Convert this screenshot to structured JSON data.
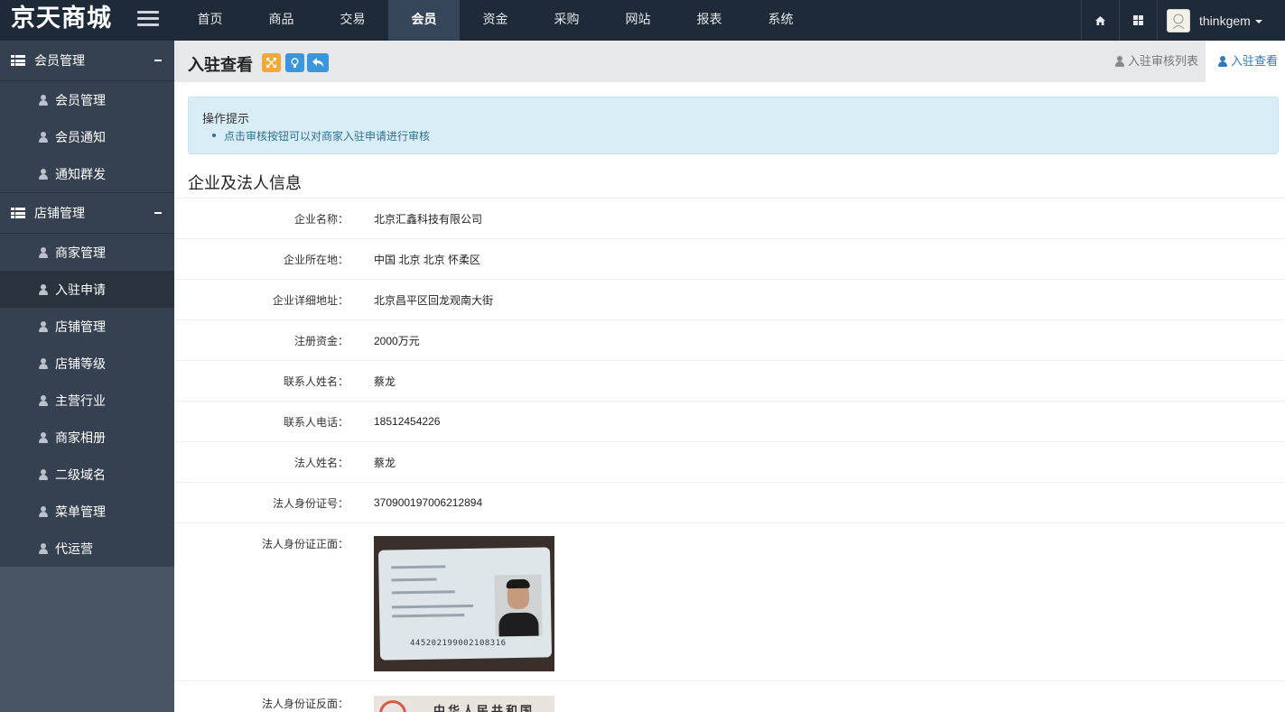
{
  "brand": "京天商城",
  "nav": [
    "首页",
    "商品",
    "交易",
    "会员",
    "资金",
    "采购",
    "网站",
    "报表",
    "系统"
  ],
  "nav_active": "会员",
  "user": {
    "name": "thinkgem"
  },
  "sidebar": {
    "groups": [
      {
        "title": "会员管理",
        "items": [
          "会员管理",
          "会员通知",
          "通知群发"
        ]
      },
      {
        "title": "店铺管理",
        "items": [
          "商家管理",
          "入驻申请",
          "店铺管理",
          "店铺等级",
          "主营行业",
          "商家相册",
          "二级域名",
          "菜单管理",
          "代运营"
        ]
      }
    ],
    "active_item": "入驻申请"
  },
  "page": {
    "title": "入驻查看",
    "tabs": [
      "入驻审核列表",
      "入驻查看"
    ],
    "active_tab": "入驻查看"
  },
  "tips": {
    "title": "操作提示",
    "items": [
      "点击审核按钮可以对商家入驻申请进行审核"
    ]
  },
  "section": {
    "title": "企业及法人信息"
  },
  "fields": [
    {
      "label": "企业名称：",
      "value": "北京汇鑫科技有限公司"
    },
    {
      "label": "企业所在地：",
      "value": "中国 北京 北京 怀柔区"
    },
    {
      "label": "企业详细地址：",
      "value": "北京昌平区回龙观南大街"
    },
    {
      "label": "注册资金：",
      "value": "2000万元"
    },
    {
      "label": "联系人姓名：",
      "value": "蔡龙"
    },
    {
      "label": "联系人电话：",
      "value": "18512454226"
    },
    {
      "label": "法人姓名：",
      "value": "蔡龙"
    },
    {
      "label": "法人身份证号：",
      "value": "370900197006212894"
    }
  ],
  "id_front": {
    "label": "法人身份证正面：",
    "card_number": "445202199002108316"
  },
  "id_back": {
    "label": "法人身份证反面：",
    "card_text": "中华人民共和国"
  },
  "colors": {
    "topbar": "#1f2a38",
    "sidebar": "#354150",
    "accent": "#2f7ab8",
    "tips_bg": "#d9edf7"
  }
}
